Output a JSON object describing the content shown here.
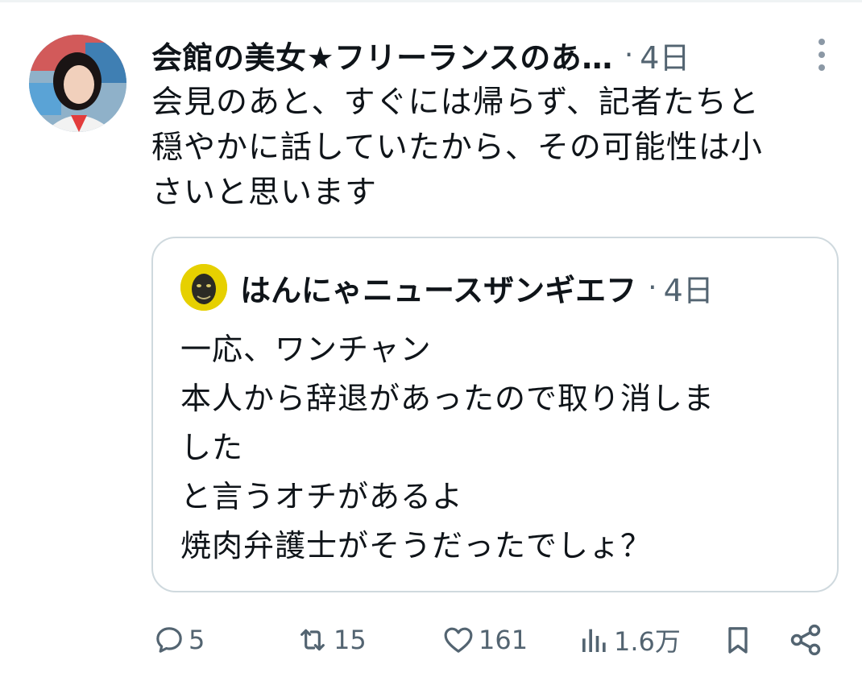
{
  "tweet": {
    "author": "会館の美女★フリーランスのあ…",
    "separator": "·",
    "time": "4日",
    "text_lines": [
      "会見のあと、すぐには帰らず、記者たちと",
      "穏やかに話していたから、その可能性は小",
      "さいと思います"
    ]
  },
  "quote": {
    "author": "はんにゃニュースザンギエフ",
    "separator": "·",
    "time": "4日",
    "text_lines": [
      "一応、ワンチャン",
      "本人から辞退があったので取り消しま",
      "した",
      "と言うオチがあるよ",
      "焼肉弁護士がそうだったでしょ？"
    ]
  },
  "actions": {
    "reply_count": "5",
    "retweet_count": "15",
    "like_count": "161",
    "view_count": "1.6万"
  },
  "icons": {
    "reply": "reply-icon",
    "retweet": "retweet-icon",
    "like": "heart-icon",
    "views": "views-icon",
    "bookmark": "bookmark-icon",
    "share": "share-icon",
    "more": "more-icon"
  },
  "colors": {
    "text": "#0f1419",
    "secondary": "#536471",
    "border": "#cfd9de"
  }
}
